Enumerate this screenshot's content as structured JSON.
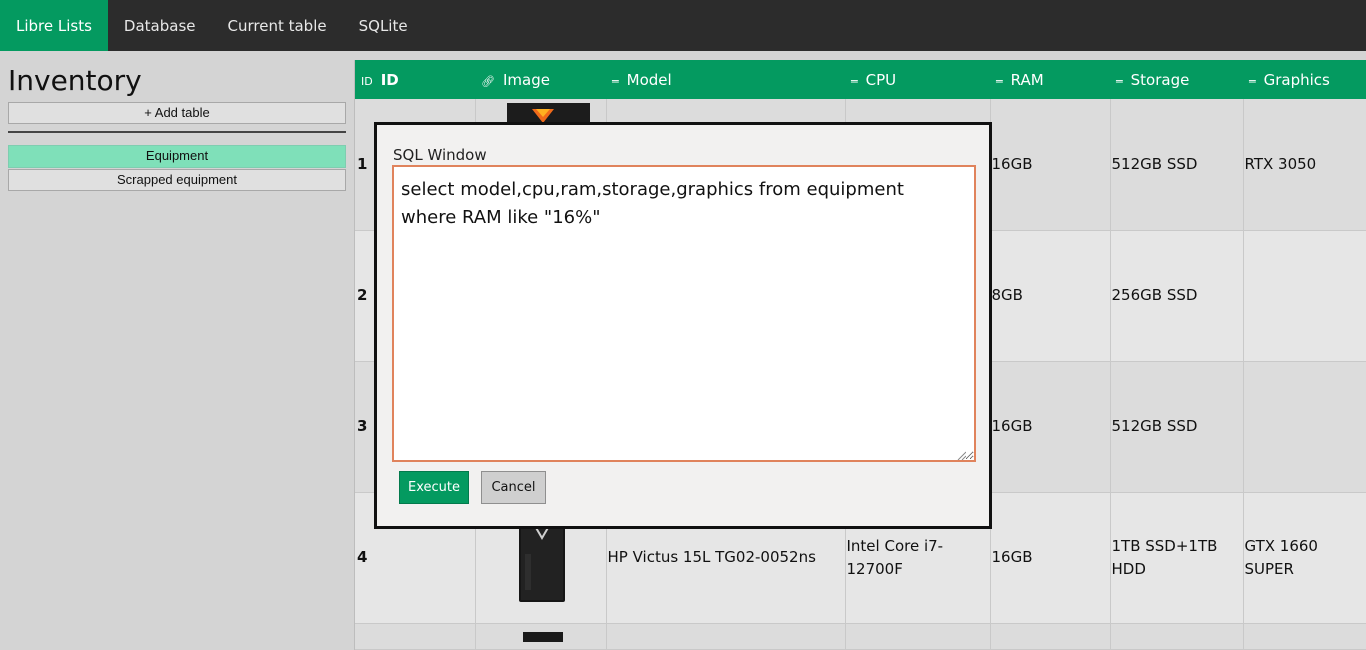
{
  "app": {
    "nav": [
      "Libre Lists",
      "Database",
      "Current table",
      "SQLite"
    ]
  },
  "sidebar": {
    "title": "Inventory",
    "add_table": "+ Add table",
    "tables": [
      "Equipment",
      "Scrapped equipment"
    ]
  },
  "table": {
    "columns": [
      {
        "icon": "ID",
        "label": "ID"
      },
      {
        "icon": "link-icon",
        "label": "Image"
      },
      {
        "icon": "text-icon",
        "label": "Model"
      },
      {
        "icon": "text-icon",
        "label": "CPU"
      },
      {
        "icon": "text-icon",
        "label": "RAM"
      },
      {
        "icon": "text-icon",
        "label": "Storage"
      },
      {
        "icon": "text-icon",
        "label": "Graphics"
      }
    ],
    "rows": [
      {
        "id": "1",
        "model": "",
        "cpu": "",
        "ram": "16GB",
        "storage": "512GB SSD",
        "graphics": "RTX 3050"
      },
      {
        "id": "2",
        "model": "",
        "cpu": "",
        "ram": "8GB",
        "storage": "256GB SSD",
        "graphics": ""
      },
      {
        "id": "3",
        "model": "",
        "cpu": "",
        "ram": "16GB",
        "storage": "512GB SSD",
        "graphics": ""
      },
      {
        "id": "4",
        "model": "HP Victus 15L TG02-0052ns",
        "cpu": "Intel Core i7-12700F",
        "ram": "16GB",
        "storage": "1TB SSD+1TB HDD",
        "graphics": "GTX 1660 SUPER"
      }
    ]
  },
  "sql_window": {
    "label": "SQL Window",
    "query": "select model,cpu,ram,storage,graphics from equipment\nwhere RAM like \"16%\"",
    "execute": "Execute",
    "cancel": "Cancel"
  },
  "colors": {
    "accent": "#049a60",
    "topbar": "#2c2c2c",
    "selected_table": "#7fe0b9",
    "textarea_border": "#e0835c"
  }
}
